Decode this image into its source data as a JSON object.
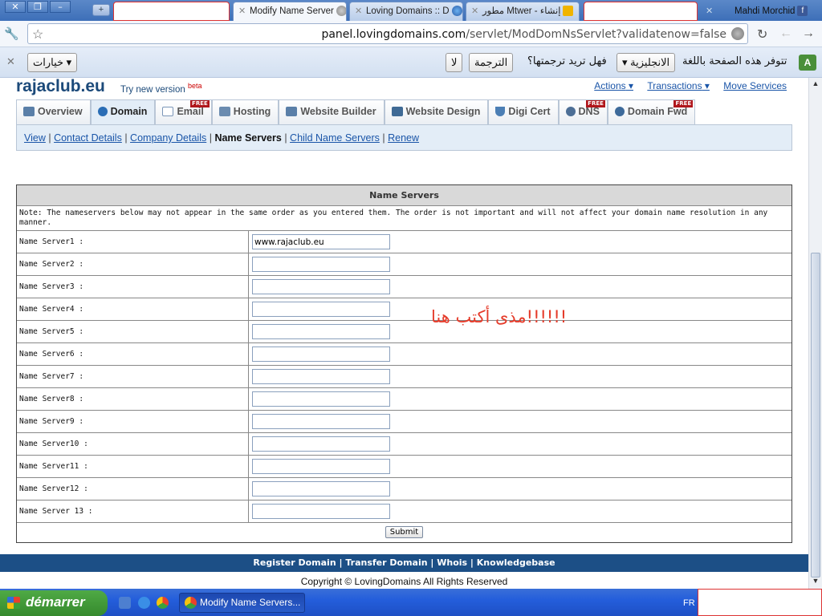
{
  "browser": {
    "tabs": [
      {
        "label": "",
        "redacted": true
      },
      {
        "label": "Modify Name Server",
        "active": true
      },
      {
        "label": "Loving Domains :: D"
      },
      {
        "label": "مطور Mtwer - إنشاء"
      },
      {
        "label": "",
        "redacted": true
      },
      {
        "label": "Mahdi Morchid"
      }
    ],
    "url_host": "panel.lovingdomains.com",
    "url_path": "/servlet/ModDomNsServlet?validatenow=false",
    "icons": [
      "wrench-icon",
      "star-icon",
      "globe-icon",
      "reload-icon",
      "back-icon",
      "forward-icon"
    ]
  },
  "infobar": {
    "message": "تتوفر هذه الصفحة باللغة",
    "language": "الانجليزية",
    "question": "فهل تريد ترجمتها؟",
    "translate_button": "الترجمة",
    "no_button": "لا",
    "options_button": "خيارات"
  },
  "site": {
    "logo": "rajaclub.eu",
    "try_new": "Try new version",
    "beta": "beta",
    "top_links": [
      "Actions",
      "Transactions",
      "Move Services"
    ],
    "tabs": [
      {
        "label": "Overview",
        "free": false,
        "color": "#5a7fa8"
      },
      {
        "label": "Domain",
        "free": false,
        "active": true,
        "color": "#2a6db5"
      },
      {
        "label": "Email",
        "free": true,
        "color": "#7b96b8"
      },
      {
        "label": "Hosting",
        "free": false,
        "color": "#6b8cb0"
      },
      {
        "label": "Website Builder",
        "free": false,
        "color": "#5a7fa8"
      },
      {
        "label": "Website Design",
        "free": false,
        "color": "#3f6a95"
      },
      {
        "label": "Digi Cert",
        "free": false,
        "color": "#4c7fb5"
      },
      {
        "label": "DNS",
        "free": true,
        "color": "#4d6f96"
      },
      {
        "label": "Domain Fwd",
        "free": true,
        "color": "#3d6a9a"
      }
    ],
    "free_badge": "FREE",
    "subnav": [
      "View",
      "Contact Details",
      "Company Details",
      "Name Servers",
      "Child Name Servers",
      "Renew"
    ],
    "subnav_current": "Name Servers"
  },
  "name_servers": {
    "title": "Name Servers",
    "note": "Note: The nameservers below may not appear in the same order as you entered them. The order is not important and will not affect your domain name resolution in any manner.",
    "rows": [
      {
        "label": "Name Server1 :",
        "value": "www.rajaclub.eu"
      },
      {
        "label": "Name Server2 :",
        "value": ""
      },
      {
        "label": "Name Server3 :",
        "value": ""
      },
      {
        "label": "Name Server4 :",
        "value": ""
      },
      {
        "label": "Name Server5 :",
        "value": ""
      },
      {
        "label": "Name Server6 :",
        "value": ""
      },
      {
        "label": "Name Server7 :",
        "value": ""
      },
      {
        "label": "Name Server8 :",
        "value": ""
      },
      {
        "label": "Name Server9 :",
        "value": ""
      },
      {
        "label": "Name Server10 :",
        "value": ""
      },
      {
        "label": "Name Server11 :",
        "value": ""
      },
      {
        "label": "Name Server12 :",
        "value": ""
      },
      {
        "label": "Name Server 13 :",
        "value": ""
      }
    ],
    "submit": "Submit",
    "annotation": "!!!!!!مذى أكتب هنا"
  },
  "footer": {
    "links": [
      "Register Domain",
      "Transfer Domain",
      "Whois",
      "Knowledgebase"
    ],
    "copyright": "Copyright © LovingDomains All Rights Reserved"
  },
  "taskbar": {
    "start": "démarrer",
    "window": "Modify Name Servers...",
    "lang": "FR"
  },
  "colors": {
    "brand_blue": "#1c4f86",
    "link": "#1a55a8",
    "annotation": "#e53b2a",
    "free_badge": "#b0161b"
  }
}
